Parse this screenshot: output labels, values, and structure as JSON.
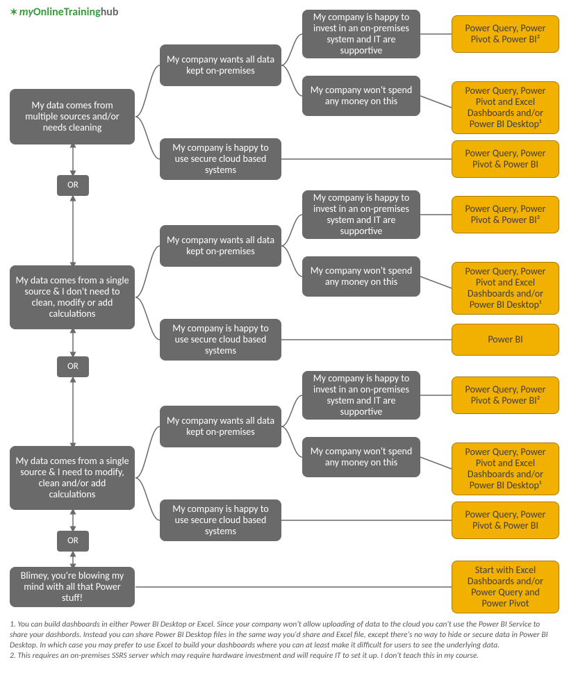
{
  "logo": {
    "my": "my",
    "online": "Online",
    "training": "Training",
    "hub": "hub"
  },
  "or": "OR",
  "roots": {
    "r1": "My data comes from multiple sources and/or needs cleaning",
    "r2": "My data comes from a single source & I don't need to clean, modify or add calculations",
    "r3": "My data comes from a single source & I need to modify, clean and/or add calculations",
    "r4": "Blimey, you're blowing my mind with all that Power stuff!"
  },
  "mid": {
    "onprem": "My company wants all data kept on-premises",
    "cloud": "My company is happy to use secure cloud based systems"
  },
  "leaf": {
    "invest": "My company is happy to invest in an on-premises system and IT are supportive",
    "nospend": "My company won't spend any money on this"
  },
  "out": {
    "pqpbi2": "Power Query, Power Pivot & Power BI²",
    "pqexcel": "Power Query, Power Pivot and Excel Dashboards and/or Power BI Desktop¹",
    "pqpbi": "Power Query, Power Pivot & Power BI",
    "pbi": "Power BI",
    "start": "Start with Excel Dashboards and/or Power Query and Power Pivot"
  },
  "footnotes": {
    "f1": "1. You can build dashboards in either Power BI Desktop or Excel. Since your company won't allow uploading of data to the cloud you can't use the Power BI Service to share your dashbords. Instead you can share Power BI Desktop files in the same way you'd share and Excel file, except there's no way to hide or secure data in Power BI Desktop. In which case you may prefer to use Excel to build your dashboards where you can at least make it difficult for users to see the underlying data.",
    "f2": "2. This requires an on-premises SSRS server which may require hardware investment and will require IT to set it up. I don't teach this in my course."
  }
}
